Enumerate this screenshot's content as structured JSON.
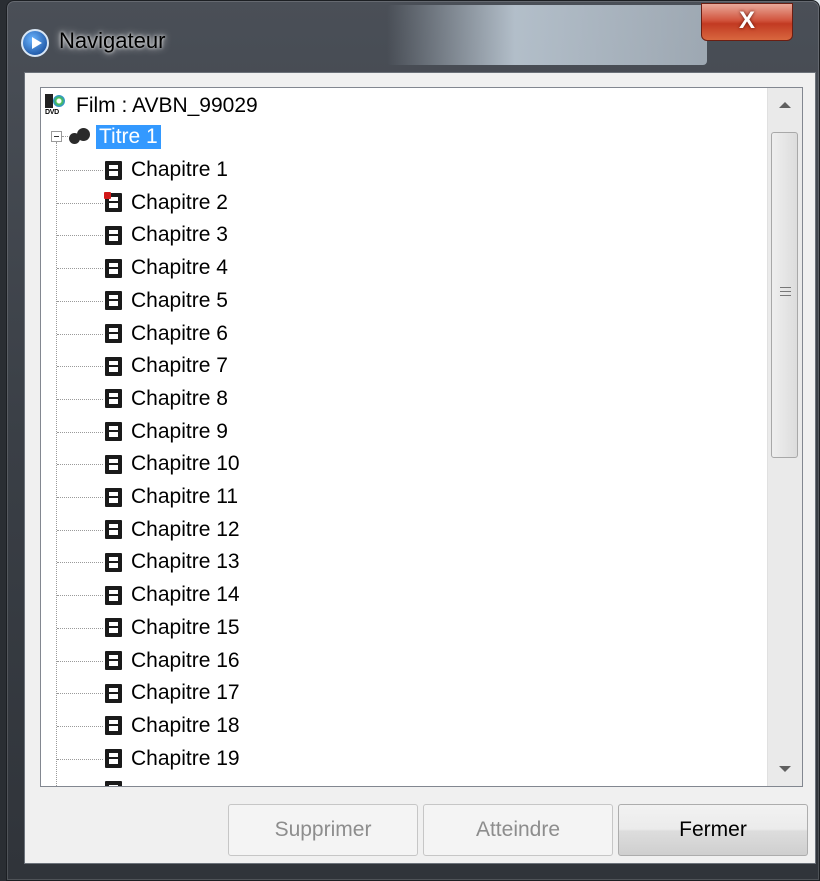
{
  "window": {
    "title": "Navigateur",
    "close_glyph": "X"
  },
  "tree": {
    "root": {
      "label": "Film : AVBN_99029",
      "icon": "dvd-film-icon"
    },
    "title_node": {
      "label": "Titre 1",
      "icon": "film-reel-icon",
      "selected": true,
      "expanded": true
    },
    "chapters": [
      {
        "label": "Chapitre 1",
        "marked": false
      },
      {
        "label": "Chapitre 2",
        "marked": true
      },
      {
        "label": "Chapitre 3",
        "marked": false
      },
      {
        "label": "Chapitre 4",
        "marked": false
      },
      {
        "label": "Chapitre 5",
        "marked": false
      },
      {
        "label": "Chapitre 6",
        "marked": false
      },
      {
        "label": "Chapitre 7",
        "marked": false
      },
      {
        "label": "Chapitre 8",
        "marked": false
      },
      {
        "label": "Chapitre 9",
        "marked": false
      },
      {
        "label": "Chapitre 10",
        "marked": false
      },
      {
        "label": "Chapitre 11",
        "marked": false
      },
      {
        "label": "Chapitre 12",
        "marked": false
      },
      {
        "label": "Chapitre 13",
        "marked": false
      },
      {
        "label": "Chapitre 14",
        "marked": false
      },
      {
        "label": "Chapitre 15",
        "marked": false
      },
      {
        "label": "Chapitre 16",
        "marked": false
      },
      {
        "label": "Chapitre 17",
        "marked": false
      },
      {
        "label": "Chapitre 18",
        "marked": false
      },
      {
        "label": "Chapitre 19",
        "marked": false
      }
    ]
  },
  "buttons": {
    "delete": {
      "label": "Supprimer",
      "enabled": false
    },
    "goto": {
      "label": "Atteindre",
      "enabled": false
    },
    "close": {
      "label": "Fermer",
      "enabled": true
    }
  },
  "colors": {
    "selection": "#3399ff",
    "marker": "#d21919",
    "close_button": "#c23a22"
  }
}
